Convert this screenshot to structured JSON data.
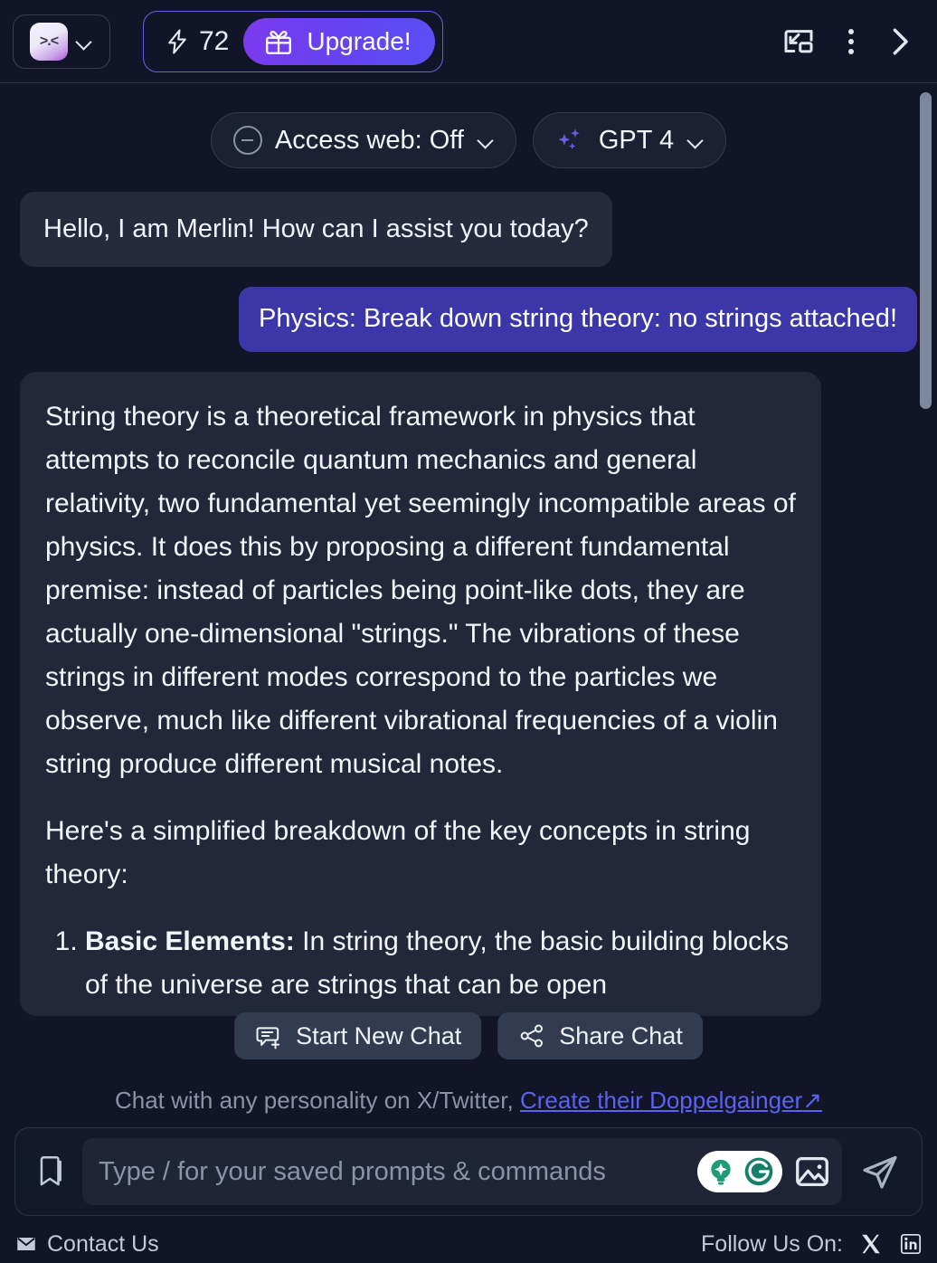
{
  "header": {
    "avatar_face": ">.<",
    "avatar_dropdown_icon": "chevron-down-icon",
    "credits_count": "72",
    "credits_icon": "lightning-bolt-icon",
    "upgrade_label": "Upgrade!",
    "upgrade_icon": "gift-icon",
    "pip_icon": "picture-in-picture-icon",
    "menu_icon": "three-dots-vertical-icon",
    "collapse_icon": "chevron-right-icon",
    "accent_color": "#6c5ce7",
    "upgrade_gradient_from": "#7b3aed",
    "upgrade_gradient_to": "#5b4ef5"
  },
  "toolbar": {
    "web_access_label": "Access web: Off",
    "web_access_icon": "circle-minus-icon",
    "model_label": "GPT 4",
    "model_icon": "sparkles-icon",
    "sparkle_color": "#6c5ce7"
  },
  "conversation": {
    "greeting": "Hello, I am Merlin! How can I assist you today?",
    "user_prompt": "Physics: Break down string theory: no strings attached!",
    "user_bubble_color": "#3b37a8",
    "answer": {
      "paragraph_1": "String theory is a theoretical framework in physics that attempts to reconcile quantum mechanics and general relativity, two fundamental yet seemingly incompatible areas of physics. It does this by proposing a different fundamental premise: instead of particles being point-like dots, they are actually one-dimensional \"strings.\" The vibrations of these strings in different modes correspond to the particles we observe, much like different vibrational frequencies of a violin string produce different musical notes.",
      "paragraph_2": "Here's a simplified breakdown of the key concepts in string theory:",
      "list_item_1_title": "Basic Elements:",
      "list_item_1_body": " In string theory, the basic building blocks of the universe are strings that can be open"
    }
  },
  "floating_actions": {
    "new_chat_label": "Start New Chat",
    "new_chat_icon": "chat-plus-icon",
    "share_label": "Share Chat",
    "share_icon": "share-nodes-icon"
  },
  "promo": {
    "text": "Chat with any personality on X/Twitter,",
    "link_text": "Create their Doppelgainger",
    "link_icon": "external-link-arrow-icon",
    "link_color": "#5b62f0"
  },
  "composer": {
    "bookmark_icon": "bookmark-icon",
    "placeholder": "Type / for your saved prompts & commands",
    "value": "",
    "assist_icon": "lightbulb-sparkle-icon",
    "grammarly_icon": "grammarly-g-icon",
    "image_icon": "image-upload-icon",
    "send_icon": "send-paper-plane-icon"
  },
  "footer": {
    "contact_label": "Contact Us",
    "contact_icon": "envelope-icon",
    "follow_label": "Follow Us On:",
    "x_icon": "x-twitter-icon",
    "linkedin_icon": "linkedin-icon"
  }
}
